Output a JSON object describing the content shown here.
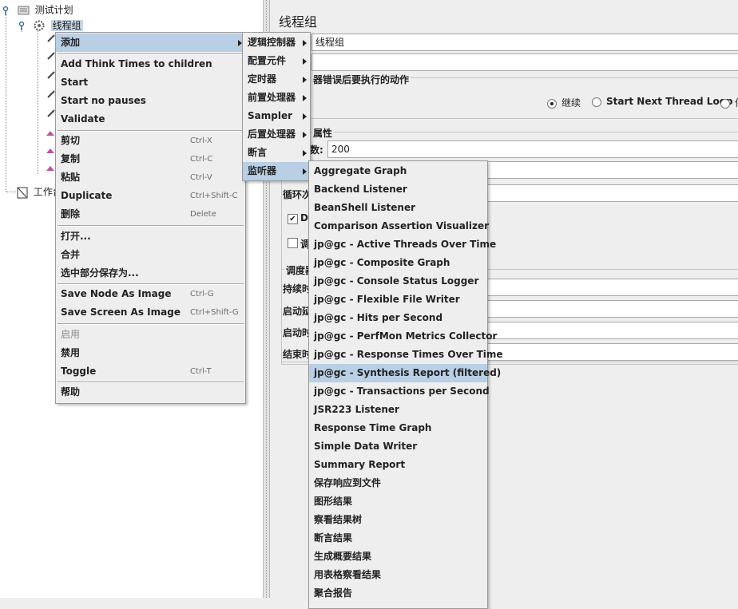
{
  "tree": {
    "root_label": "测试计划",
    "thread_group_label": "线程组",
    "workbench_label": "工作台"
  },
  "panel": {
    "title": "线程组",
    "name_value": "线程组",
    "error_action_label": "器错误后要执行的动作",
    "radio_continue": "继续",
    "radio_start_next": "Start Next Thread Loop",
    "radio_partial": "停",
    "props_label": "属性",
    "threads_label_partial": "数:",
    "threads_value": "200",
    "loop_label_partial": "循环次",
    "delay_label_partial": "D",
    "scheduler_label_partial": "调",
    "schedule_group_partial": "调度器",
    "duration_partial": "持续时",
    "start_delay_partial": "启动延",
    "start_time_partial": "启动时",
    "end_time_partial": "结束时"
  },
  "context_menu": {
    "items": [
      {
        "label": "添加"
      },
      {
        "label": "Add Think Times to children"
      },
      {
        "label": "Start"
      },
      {
        "label": "Start no pauses"
      },
      {
        "label": "Validate"
      },
      {
        "label": "剪切",
        "shortcut": "Ctrl-X"
      },
      {
        "label": "复制",
        "shortcut": "Ctrl-C"
      },
      {
        "label": "粘贴",
        "shortcut": "Ctrl-V"
      },
      {
        "label": "Duplicate",
        "shortcut": "Ctrl+Shift-C"
      },
      {
        "label": "删除",
        "shortcut": "Delete"
      },
      {
        "label": "打开..."
      },
      {
        "label": "合并"
      },
      {
        "label": "选中部分保存为..."
      },
      {
        "label": "Save Node As Image",
        "shortcut": "Ctrl-G"
      },
      {
        "label": "Save Screen As Image",
        "shortcut": "Ctrl+Shift-G"
      },
      {
        "label": "启用"
      },
      {
        "label": "禁用"
      },
      {
        "label": "Toggle",
        "shortcut": "Ctrl-T"
      },
      {
        "label": "帮助"
      }
    ]
  },
  "add_submenu": {
    "items": [
      {
        "label": "逻辑控制器"
      },
      {
        "label": "配置元件"
      },
      {
        "label": "定时器"
      },
      {
        "label": "前置处理器"
      },
      {
        "label": "Sampler"
      },
      {
        "label": "后置处理器"
      },
      {
        "label": "断言"
      },
      {
        "label": "监听器"
      }
    ]
  },
  "listener_submenu": {
    "items": [
      {
        "label": "Aggregate Graph"
      },
      {
        "label": "Backend Listener"
      },
      {
        "label": "BeanShell Listener"
      },
      {
        "label": "Comparison Assertion Visualizer"
      },
      {
        "label": "jp@gc - Active Threads Over Time"
      },
      {
        "label": "jp@gc - Composite Graph"
      },
      {
        "label": "jp@gc - Console Status Logger"
      },
      {
        "label": "jp@gc - Flexible File Writer"
      },
      {
        "label": "jp@gc - Hits per Second"
      },
      {
        "label": "jp@gc - PerfMon Metrics Collector"
      },
      {
        "label": "jp@gc - Response Times Over Time"
      },
      {
        "label": "jp@gc - Synthesis Report (filtered)"
      },
      {
        "label": "jp@gc - Transactions per Second"
      },
      {
        "label": "JSR223 Listener"
      },
      {
        "label": "Response Time Graph"
      },
      {
        "label": "Simple Data Writer"
      },
      {
        "label": "Summary Report"
      },
      {
        "label": "保存响应到文件"
      },
      {
        "label": "图形结果"
      },
      {
        "label": "察看结果树"
      },
      {
        "label": "断言结果"
      },
      {
        "label": "生成概要结果"
      },
      {
        "label": "用表格察看结果"
      },
      {
        "label": "聚合报告"
      }
    ]
  }
}
